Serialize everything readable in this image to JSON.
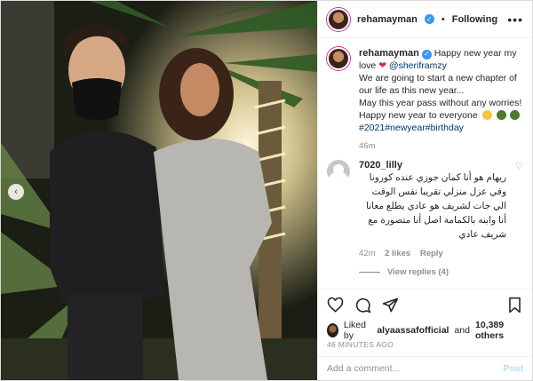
{
  "post": {
    "username": "rehamayman",
    "follow_label": "Following",
    "caption": {
      "username": "rehamayman",
      "line1": "Happy new year my love",
      "mention": "@sheriframzy",
      "line2": "We are going to start a new chapter of our life as this new year...",
      "line3": "May this year pass without any worries!",
      "line4": "Happy new year to everyone",
      "hashtags": "#2021#newyear#birthday",
      "time": "46m"
    },
    "comment": {
      "username": "7020_lilly",
      "text": "ريهام هو أنا كمان جوزي عنده كورونا وفي عزل منزلي تقريبا نفس الوقت الي جات لشريف هو عادي يطلع معانا أنا وابنه بالكمامة اصل أنا متصورة مع شريف عادي",
      "time": "42m",
      "likes": "2 likes",
      "reply": "Reply",
      "view_replies": "View replies (4)"
    },
    "liked_by": {
      "prefix": "Liked by",
      "user": "alyaassafofficial",
      "middle": "and",
      "others": "10,389 others"
    },
    "timestamp": "46 MINUTES AGO",
    "add_comment_placeholder": "Add a comment...",
    "post_label": "Post"
  },
  "colors": {
    "link": "#00376b",
    "verified": "#3897f0",
    "post_disabled": "#b2dffc"
  }
}
